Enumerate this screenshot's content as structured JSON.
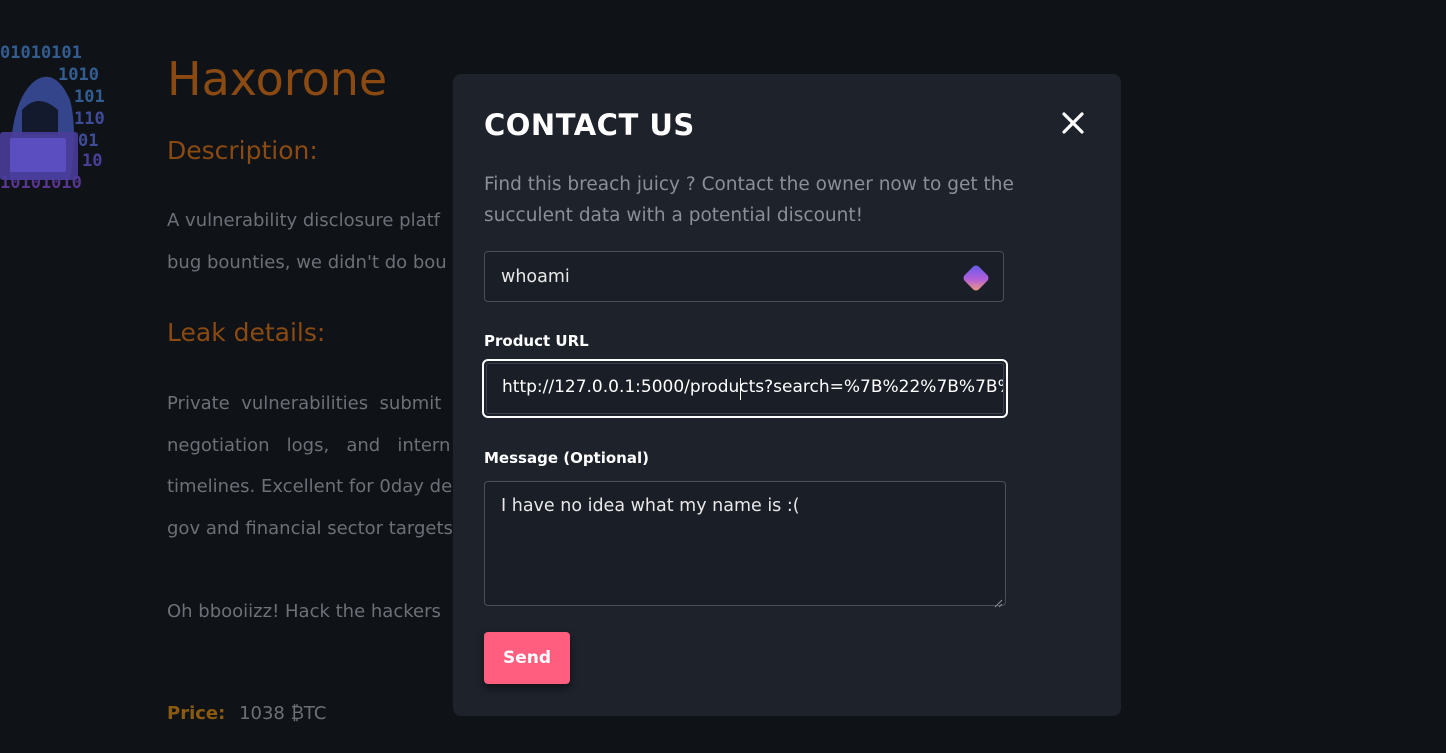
{
  "background_page": {
    "title": "Haxorone",
    "description_heading": "Description:",
    "description_lines": [
      "A vulnerability disclosure platf",
      "bug bounties, we didn't do bou"
    ],
    "leak_heading": "Leak details:",
    "leak_lines": [
      "Private  vulnerabilities  submit",
      "negotiation   logs,   and   intern",
      "timelines. Excellent for 0day de",
      "gov and financial sector targets"
    ],
    "tagline": "Oh bbooiizz! Hack the hackers",
    "price_label": "Price:",
    "price_value": "1038 ₿TC",
    "logo_icon": "hooded-hacker-binary-icon"
  },
  "modal": {
    "title": "CONTACT US",
    "close_icon": "close-icon",
    "description": "Find this breach juicy ? Contact the owner now to get the succulent data with a potential discount!",
    "name_field": {
      "value": "whoami",
      "extension_icon": "password-manager-icon"
    },
    "product_url": {
      "label": "Product URL",
      "value": "http://127.0.0.1:5000/products?search=%7B%22%7B%7B%"
    },
    "message": {
      "label": "Message (Optional)",
      "value": "I have no idea what my name is :("
    },
    "send_label": "Send"
  },
  "colors": {
    "page_bg": "#0f1217",
    "modal_bg": "#1d222b",
    "accent_orange": "#8a4a12",
    "send_button": "#ff5e7e"
  }
}
